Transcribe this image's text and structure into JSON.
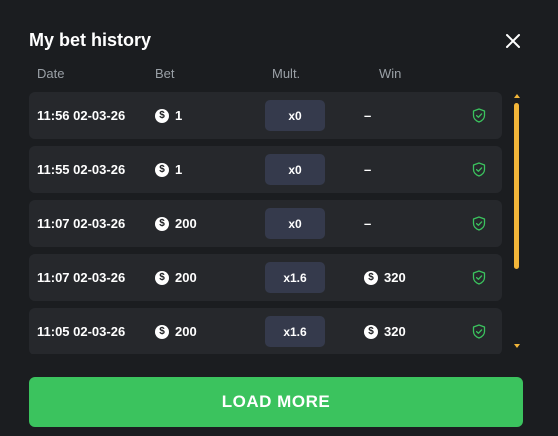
{
  "title": "My bet history",
  "columns": {
    "date": "Date",
    "bet": "Bet",
    "mult": "Mult.",
    "win": "Win"
  },
  "coin_symbol": "$",
  "rows": [
    {
      "date": "11:56 02-03-26",
      "bet": "1",
      "mult": "x0",
      "win": "–",
      "win_has_coin": false
    },
    {
      "date": "11:55 02-03-26",
      "bet": "1",
      "mult": "x0",
      "win": "–",
      "win_has_coin": false
    },
    {
      "date": "11:07 02-03-26",
      "bet": "200",
      "mult": "x0",
      "win": "–",
      "win_has_coin": false
    },
    {
      "date": "11:07 02-03-26",
      "bet": "200",
      "mult": "x1.6",
      "win": "320",
      "win_has_coin": true
    },
    {
      "date": "11:05 02-03-26",
      "bet": "200",
      "mult": "x1.6",
      "win": "320",
      "win_has_coin": true
    }
  ],
  "load_more": "LOAD MORE",
  "colors": {
    "background": "#1b1d20",
    "row": "#26282c",
    "mult_pill": "#353a4c",
    "shield": "#3bc35e",
    "scrollbar": "#f3b639",
    "button": "#3bc35e"
  },
  "icons": {
    "close": "close-icon",
    "coin": "coin-icon",
    "verified": "shield-check-icon"
  }
}
